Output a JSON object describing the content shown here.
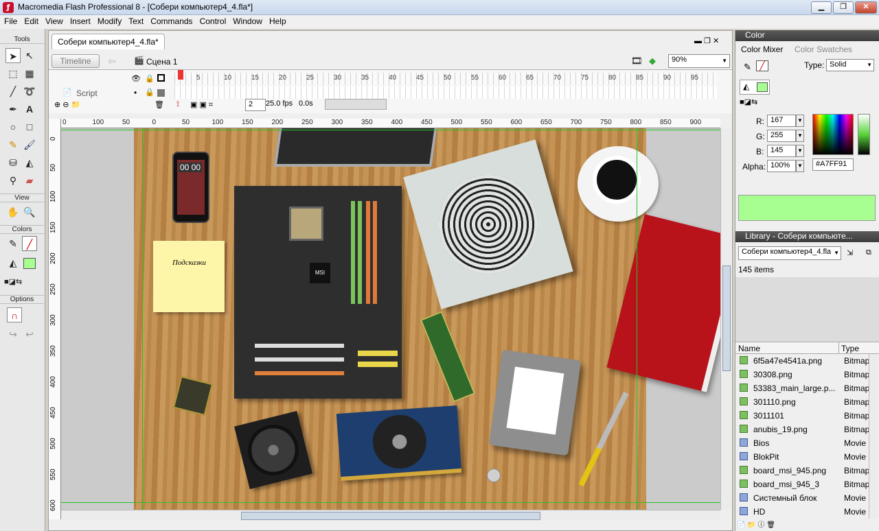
{
  "app": {
    "title": "Macromedia Flash Professional 8 - [Собери компьютер4_4.fla*]",
    "icon": "flash-app-icon"
  },
  "menu": [
    "File",
    "Edit",
    "View",
    "Insert",
    "Modify",
    "Text",
    "Commands",
    "Control",
    "Window",
    "Help"
  ],
  "tools": {
    "title": "Tools",
    "view_label": "View",
    "colors_label": "Colors",
    "options_label": "Options",
    "fill_color": "#A7FF91"
  },
  "document": {
    "tab_label": "Собери компьютер4_4.fla*",
    "timeline_button": "Timeline",
    "scene_label": "Сцена 1",
    "zoom": "90%",
    "layer_name": "Script",
    "current_frame": "2",
    "fps": "25.0 fps",
    "time": "0.0s",
    "frame_numbers": [
      "5",
      "10",
      "15",
      "20",
      "25",
      "30",
      "35",
      "40",
      "45",
      "50",
      "55",
      "60",
      "65",
      "70",
      "75",
      "80",
      "85",
      "90",
      "95"
    ],
    "h_ruler_ticks": [
      "0",
      "100",
      "50",
      "0",
      "50",
      "100",
      "150",
      "200",
      "250",
      "300",
      "350",
      "400",
      "450",
      "500",
      "550",
      "600",
      "650",
      "700",
      "750",
      "800",
      "850",
      "900"
    ],
    "v_ruler_ticks": [
      "0",
      "50",
      "100",
      "150",
      "200",
      "250",
      "300",
      "350",
      "400",
      "450",
      "500",
      "550",
      "600"
    ],
    "sticky_note_text": "Подсказки",
    "phone_clock": "00 00",
    "chip_brand": "MSI"
  },
  "color_panel": {
    "title": "Color",
    "tab_mixer": "Color Mixer",
    "tab_swatches": "Color Swatches",
    "type_label": "Type:",
    "type_value": "Solid",
    "r_label": "R:",
    "r_value": "167",
    "g_label": "G:",
    "g_value": "255",
    "b_label": "B:",
    "b_value": "145",
    "alpha_label": "Alpha:",
    "alpha_value": "100%",
    "hex_value": "#A7FF91",
    "preview_color": "#A7FF91"
  },
  "library_panel": {
    "title": "Library - Собери компьюте...",
    "document_select": "Собери компьютер4_4.fla",
    "item_count": "145 items",
    "col_name": "Name",
    "col_type": "Type",
    "items": [
      {
        "name": "6f5a47e4541a.png",
        "type": "Bitmap",
        "kind": "bitmap"
      },
      {
        "name": "30308.png",
        "type": "Bitmap",
        "kind": "bitmap"
      },
      {
        "name": "53383_main_large.p...",
        "type": "Bitmap",
        "kind": "bitmap"
      },
      {
        "name": "301110.png",
        "type": "Bitmap",
        "kind": "bitmap"
      },
      {
        "name": "3011101",
        "type": "Bitmap",
        "kind": "bitmap"
      },
      {
        "name": "anubis_19.png",
        "type": "Bitmap",
        "kind": "bitmap"
      },
      {
        "name": "Bios",
        "type": "Movie",
        "kind": "movie"
      },
      {
        "name": "BlokPit",
        "type": "Movie",
        "kind": "movie"
      },
      {
        "name": "board_msi_945.png",
        "type": "Bitmap",
        "kind": "bitmap"
      },
      {
        "name": "board_msi_945_3",
        "type": "Bitmap",
        "kind": "bitmap"
      },
      {
        "name": "Системный блок",
        "type": "Movie",
        "kind": "movie"
      },
      {
        "name": "HD",
        "type": "Movie",
        "kind": "movie"
      }
    ]
  }
}
